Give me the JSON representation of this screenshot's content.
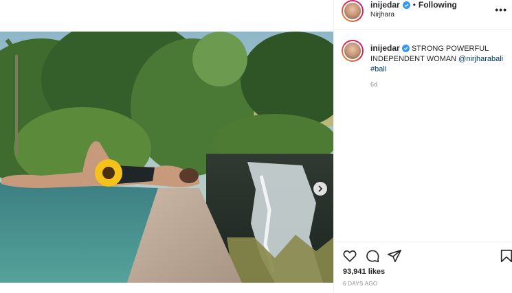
{
  "post": {
    "username": "inijedar",
    "location": "Nirjhara",
    "follow_status": "Following",
    "separator": "•",
    "more_label": "•••"
  },
  "caption": {
    "username": "inijedar",
    "text": "STRONG POWERFUL INDEPENDENT WOMAN",
    "mention": "@nirjharabali",
    "hashtag": "#bali",
    "time": "6d"
  },
  "stats": {
    "likes": "93,941 likes",
    "posted": "6 DAYS AGO"
  },
  "icons": {
    "like": "heart-icon",
    "comment": "comment-icon",
    "share": "paper-plane-icon",
    "save": "bookmark-icon",
    "verified": "verified-badge-icon",
    "next": "chevron-right-icon"
  },
  "colors": {
    "link": "#00376b",
    "verified": "#3897f0",
    "muted": "#8e8e8e",
    "text": "#262626"
  }
}
